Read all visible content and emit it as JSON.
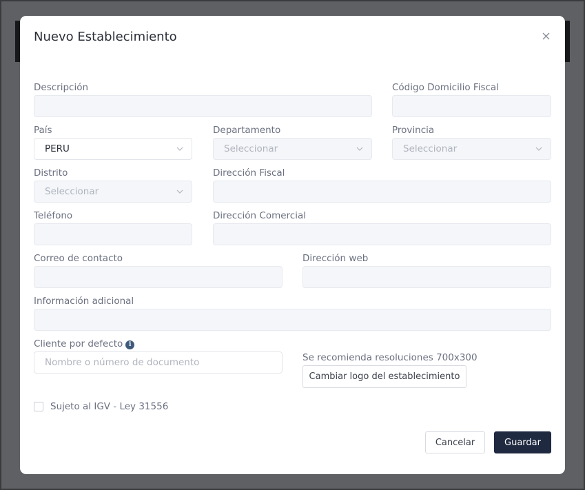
{
  "modal": {
    "title": "Nuevo Establecimiento"
  },
  "fields": {
    "descripcion": {
      "label": "Descripción",
      "value": ""
    },
    "codigo_domicilio": {
      "label": "Código Domicilio Fiscal",
      "value": ""
    },
    "pais": {
      "label": "País",
      "value": "PERU"
    },
    "departamento": {
      "label": "Departamento",
      "placeholder": "Seleccionar"
    },
    "provincia": {
      "label": "Provincia",
      "placeholder": "Seleccionar"
    },
    "distrito": {
      "label": "Distrito",
      "placeholder": "Seleccionar"
    },
    "direccion_fiscal": {
      "label": "Dirección Fiscal",
      "value": ""
    },
    "telefono": {
      "label": "Teléfono",
      "value": ""
    },
    "direccion_comercial": {
      "label": "Dirección Comercial",
      "value": ""
    },
    "correo": {
      "label": "Correo de contacto",
      "value": ""
    },
    "direccion_web": {
      "label": "Dirección web",
      "value": ""
    },
    "info_adicional": {
      "label": "Información adicional",
      "value": ""
    },
    "cliente_defecto": {
      "label": "Cliente por defecto",
      "placeholder": "Nombre o número de documento"
    }
  },
  "logo": {
    "hint": "Se recomienda resoluciones 700x300",
    "button_label": "Cambiar logo del establecimiento"
  },
  "igv": {
    "label": "Sujeto al IGV - Ley 31556",
    "checked": false
  },
  "actions": {
    "cancel_label": "Cancelar",
    "save_label": "Guardar"
  },
  "icons": {
    "close": "close-icon",
    "chevron": "chevron-down-icon",
    "info": "info-icon"
  },
  "colors": {
    "primary": "#1f2940",
    "input_bg": "#f4f6f9",
    "backdrop": "#5f6063"
  }
}
